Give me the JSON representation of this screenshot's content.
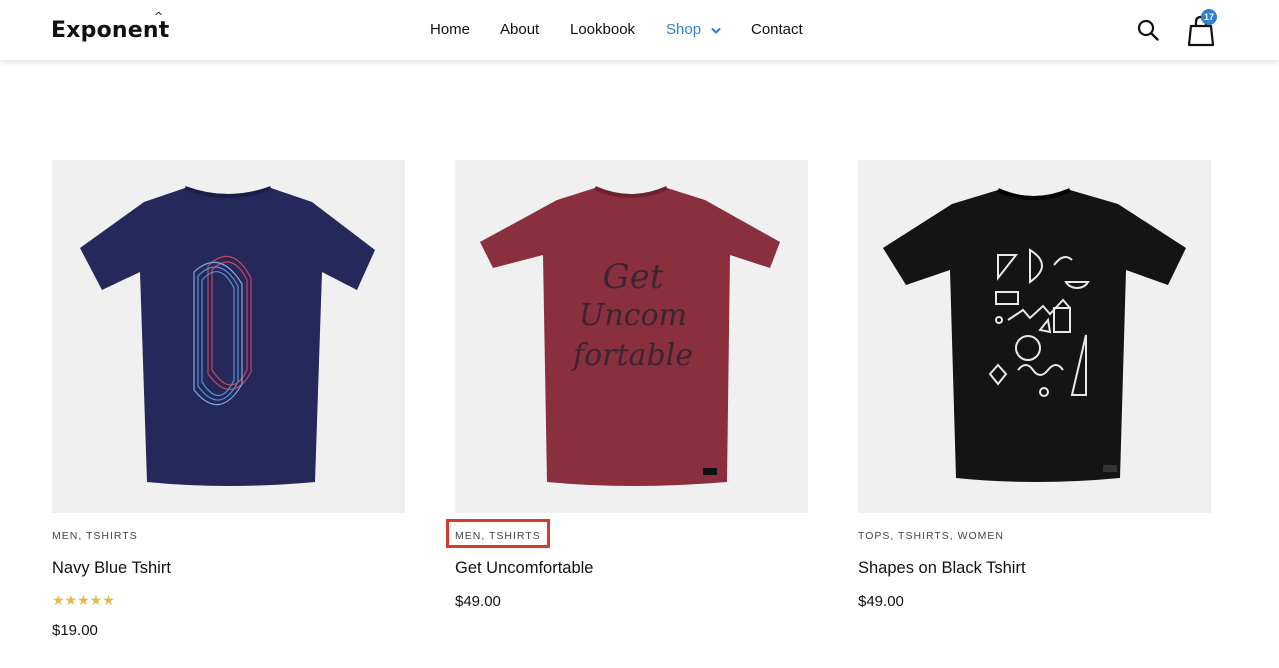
{
  "header": {
    "logo": "Exponent",
    "logo_accent": "^",
    "nav": {
      "home": "Home",
      "about": "About",
      "lookbook": "Lookbook",
      "shop": "Shop",
      "contact": "Contact"
    },
    "cart_count": "17",
    "icons": [
      "search-icon",
      "shopping-bag-icon",
      "chevron-down-icon"
    ],
    "accent_color": "#2f7fd1"
  },
  "products": [
    {
      "categories": "MEN, TSHIRTS",
      "title": "Navy Blue Tshirt",
      "rating": 5,
      "stars": "★★★★★",
      "price": "$19.00",
      "shirt_color": "#24285a"
    },
    {
      "categories": "MEN, TSHIRTS",
      "title": "Get Uncomfortable",
      "price": "$49.00",
      "shirt_color": "#8a2f3e",
      "print_text": "Get Uncom-fortable"
    },
    {
      "categories": "TOPS, TSHIRTS, WOMEN",
      "title": "Shapes on Black Tshirt",
      "price": "$49.00",
      "shirt_color": "#141414"
    }
  ],
  "highlight_color": "#d63a2b"
}
